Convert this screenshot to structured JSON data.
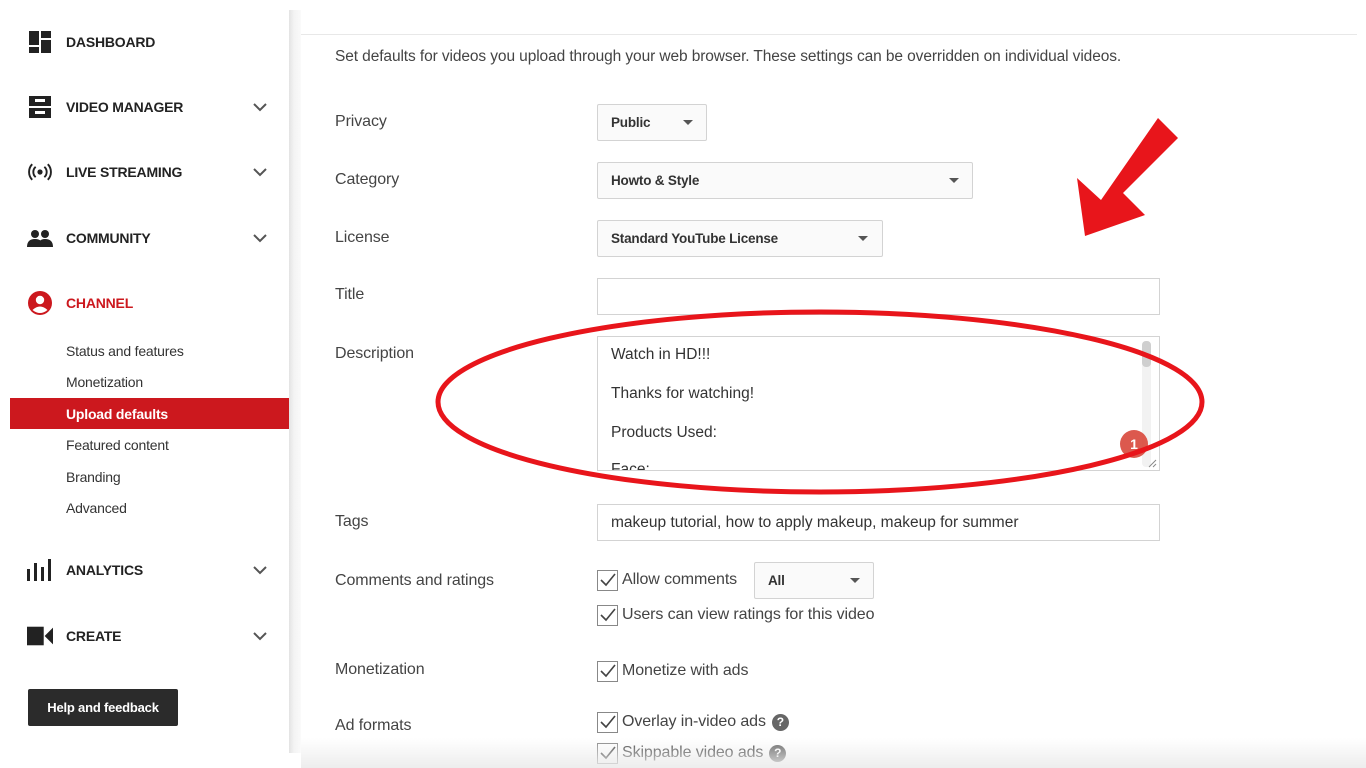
{
  "sidebar": {
    "nav": [
      {
        "label": "DASHBOARD",
        "icon": "dashboard-icon"
      },
      {
        "label": "VIDEO MANAGER",
        "icon": "video-manager-icon"
      },
      {
        "label": "LIVE STREAMING",
        "icon": "live-streaming-icon"
      },
      {
        "label": "COMMUNITY",
        "icon": "community-icon"
      },
      {
        "label": "CHANNEL",
        "icon": "channel-icon"
      },
      {
        "label": "ANALYTICS",
        "icon": "analytics-icon"
      },
      {
        "label": "CREATE",
        "icon": "create-icon"
      }
    ],
    "channel_items": [
      "Status and features",
      "Monetization",
      "Upload defaults",
      "Featured content",
      "Branding",
      "Advanced"
    ],
    "help_label": "Help and feedback"
  },
  "main": {
    "intro": "Set defaults for videos you upload through your web browser. These settings can be overridden on individual videos.",
    "privacy": {
      "label": "Privacy",
      "value": "Public"
    },
    "category": {
      "label": "Category",
      "value": "Howto & Style"
    },
    "license": {
      "label": "License",
      "value": "Standard YouTube License"
    },
    "title": {
      "label": "Title",
      "value": ""
    },
    "description": {
      "label": "Description",
      "lines": [
        "Watch in HD!!!",
        "Thanks for watching!",
        "Products Used:",
        "Face:"
      ]
    },
    "tags": {
      "label": "Tags",
      "value": "makeup tutorial, how to apply makeup, makeup for summer"
    },
    "comments": {
      "label": "Comments and ratings",
      "allow_comments": "Allow comments",
      "comments_select": "All",
      "view_ratings": "Users can view ratings for this video"
    },
    "monetization": {
      "label": "Monetization",
      "monetize": "Monetize with ads"
    },
    "ad_formats": {
      "label": "Ad formats",
      "overlay": "Overlay in-video ads",
      "skippable": "Skippable video ads"
    },
    "badge_count": "1"
  },
  "colors": {
    "accent": "#cc181e",
    "annotation": "#e8151b"
  }
}
